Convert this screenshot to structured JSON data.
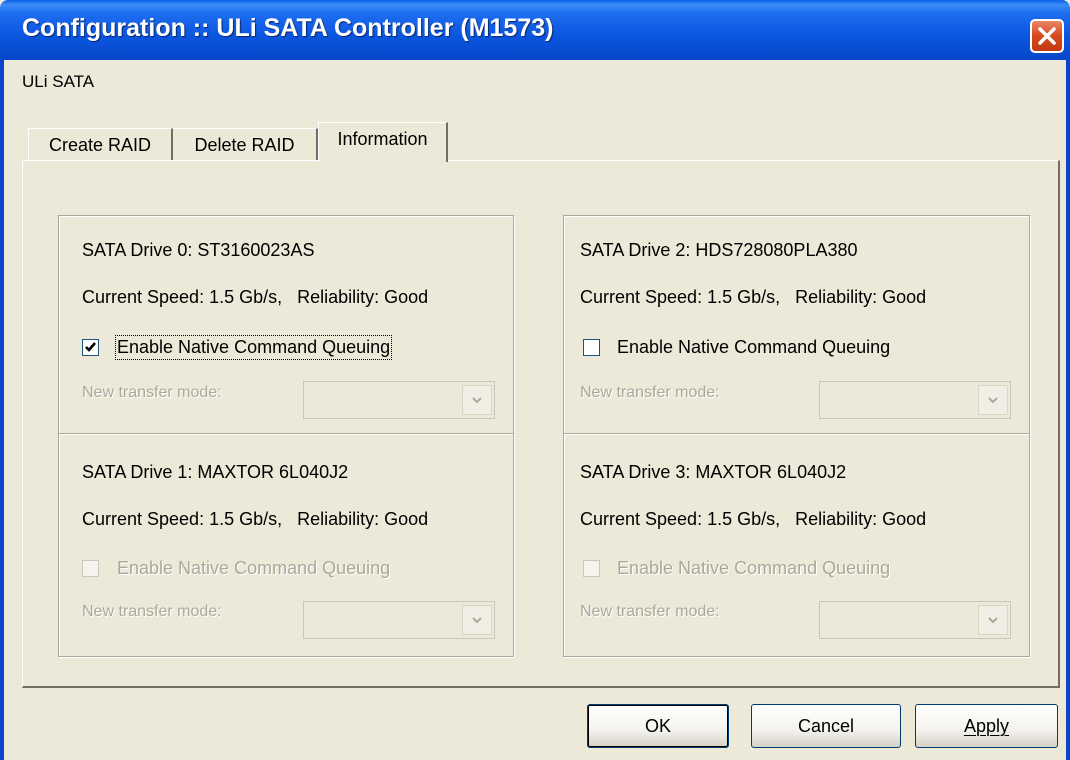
{
  "window": {
    "title": "Configuration :: ULi SATA Controller (M1573)",
    "subtitle": "ULi SATA"
  },
  "tabs": [
    {
      "label": "Create RAID"
    },
    {
      "label": "Delete RAID"
    },
    {
      "label": "Information",
      "active": true
    }
  ],
  "drives": [
    {
      "name": "SATA Drive 0: ST3160023AS",
      "speed": "Current Speed: 1.5 Gb/s,   Reliability: Good",
      "ncq_label": "Enable Native Command Queuing",
      "ncq_checked": true,
      "ncq_enabled": true,
      "transfer_label": "New transfer mode:"
    },
    {
      "name": "SATA Drive 1: MAXTOR 6L040J2",
      "speed": "Current Speed: 1.5 Gb/s,   Reliability: Good",
      "ncq_label": "Enable Native Command Queuing",
      "ncq_checked": false,
      "ncq_enabled": false,
      "transfer_label": "New transfer mode:"
    },
    {
      "name": "SATA Drive 2: HDS728080PLA380",
      "speed": "Current Speed: 1.5 Gb/s,   Reliability: Good",
      "ncq_label": "Enable Native Command Queuing",
      "ncq_checked": false,
      "ncq_enabled": true,
      "transfer_label": "New transfer mode:"
    },
    {
      "name": "SATA Drive 3: MAXTOR 6L040J2",
      "speed": "Current Speed: 1.5 Gb/s,   Reliability: Good",
      "ncq_label": "Enable Native Command Queuing",
      "ncq_checked": false,
      "ncq_enabled": false,
      "transfer_label": "New transfer mode:"
    }
  ],
  "buttons": {
    "ok": "OK",
    "cancel": "Cancel",
    "apply": "Apply"
  },
  "colors": {
    "title_bar": "#0a56df",
    "dialog_bg": "#ece9d8",
    "close_button": "#d8491f",
    "disabled_text": "#aca899"
  },
  "icons": {
    "close": "close-icon",
    "check": "checkmark-icon",
    "dropdown": "chevron-down-icon"
  }
}
